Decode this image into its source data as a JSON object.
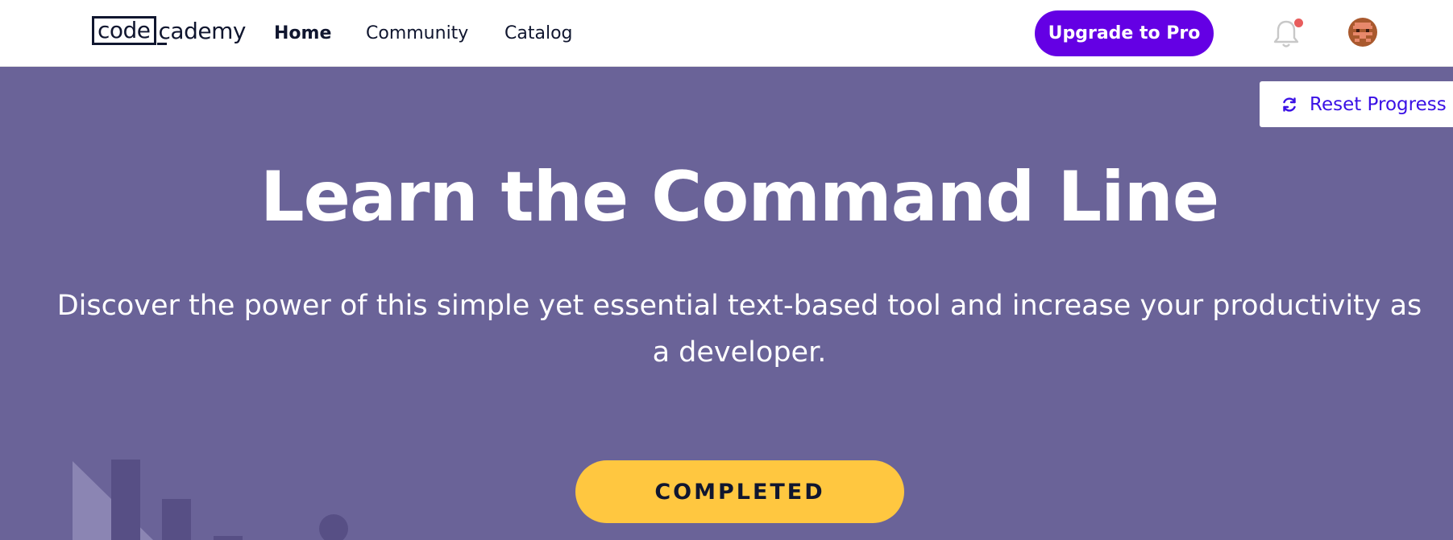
{
  "header": {
    "logo_box": "code",
    "logo_rest": "cademy",
    "nav": {
      "home": "Home",
      "community": "Community",
      "catalog": "Catalog"
    },
    "upgrade_label": "Upgrade to Pro",
    "notification_icon": "bell-icon",
    "has_unread_notification": true
  },
  "hero": {
    "reset_label": "Reset Progress",
    "reset_icon": "refresh-icon",
    "title": "Learn the Command Line",
    "description": "Discover the power of this simple yet essential text-based tool and increase your productivity as a developer.",
    "status_label": "COMPLETED"
  },
  "colors": {
    "brand_purple": "#6400e4",
    "hero_bg": "#6a6398",
    "completed_yellow": "#ffc740",
    "link_blue": "#3a10e5",
    "notification_dot": "#e85d5d"
  }
}
